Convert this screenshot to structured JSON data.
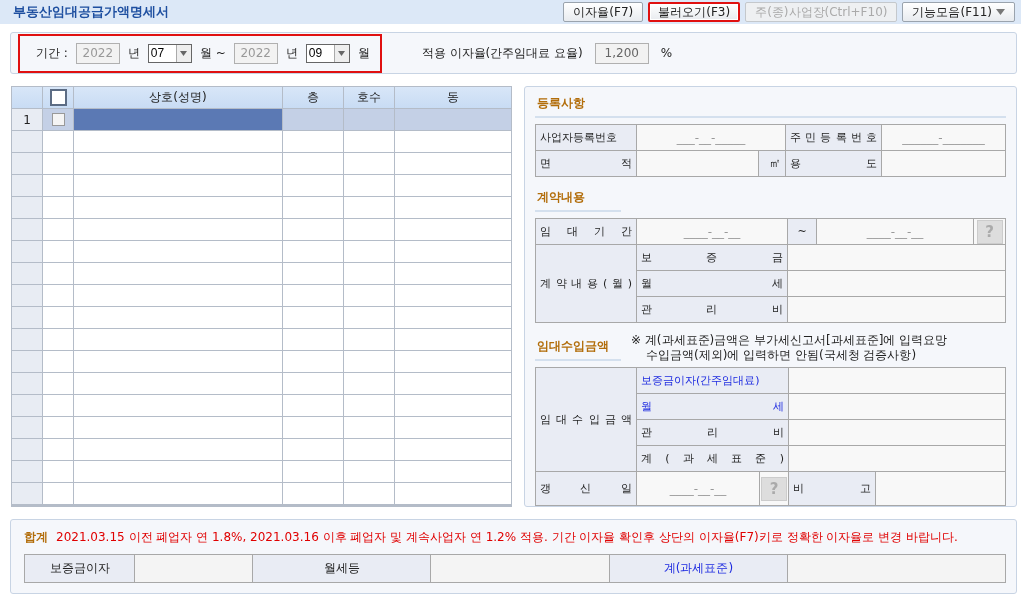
{
  "title": "부동산임대공급가액명세서",
  "toolbar": [
    {
      "kind": "button",
      "label": "이자율(F7)",
      "disabled": false,
      "highlighted": false
    },
    {
      "kind": "button",
      "label": "불러오기(F3)",
      "disabled": false,
      "highlighted": true
    },
    {
      "kind": "button",
      "label": "주(종)사업장(Ctrl+F10)",
      "disabled": true,
      "highlighted": false
    },
    {
      "kind": "menu",
      "label": "기능모음(F11)",
      "disabled": false,
      "highlighted": false
    }
  ],
  "period": {
    "label": "기간 :",
    "highlighted": true,
    "parts": [
      {
        "kind": "year",
        "value": "2022",
        "disabled": true
      },
      {
        "kind": "unit",
        "text": "년"
      },
      {
        "kind": "month",
        "value": "07"
      },
      {
        "kind": "unit",
        "text": "월 ~"
      },
      {
        "kind": "year",
        "value": "2022",
        "disabled": true
      },
      {
        "kind": "unit",
        "text": "년"
      },
      {
        "kind": "month",
        "value": "09"
      },
      {
        "kind": "unit",
        "text": "월"
      }
    ]
  },
  "rate": {
    "label": "적용 이자율(간주임대료 요율)",
    "value": "1,200",
    "unit": "%"
  },
  "grid": {
    "header_checked": false,
    "columns": [
      "상호(성명)",
      "층",
      "호수",
      "동"
    ],
    "rows": [
      {
        "number": "1",
        "checked": false,
        "selected": true
      }
    ]
  },
  "registration": {
    "title": "등록사항",
    "business_no": {
      "label": "사업자등록번호",
      "placeholder": "___-__-_____"
    },
    "resident_no": {
      "label": "주 민 등 록 번 호",
      "placeholder": "______-_______"
    },
    "area": {
      "label": "면 적",
      "unit": "㎡"
    },
    "usage": {
      "label": "용 도"
    }
  },
  "contract": {
    "title": "계약내용",
    "period": {
      "label": "임 대 기 간",
      "from_placeholder": "____-__-__",
      "separator": "~",
      "to_placeholder": "____-__-__",
      "help_button": "?"
    },
    "label": "계 약 내 용 ( 월 )",
    "items": [
      {
        "label": "보 증 금"
      },
      {
        "label": "월 세"
      },
      {
        "label": "관 리 비"
      }
    ]
  },
  "income": {
    "title": "임대수입금액",
    "note": [
      "※ 계(과세표준)금액은 부가세신고서[과세표준]에 입력요망",
      "수입금액(제외)에 입력하면 안됨(국세청 검증사항)"
    ],
    "label": "임 대 수 입 금 액",
    "items": [
      {
        "label": "보증금이자(간주임대료)",
        "emphasized": true
      },
      {
        "label": "월 세",
        "emphasized": true
      },
      {
        "label": "관 리 비",
        "emphasized": false
      },
      {
        "label": "계 ( 과 세 표 준 )",
        "emphasized": false
      }
    ],
    "renewal": {
      "label": "갱 신 일",
      "placeholder": "____-__-__",
      "help_button": "?"
    },
    "remark": {
      "label": "비 고"
    }
  },
  "summary": {
    "title": "합계",
    "notice": "2021.03.15 이전 폐업자 연 1.8%, 2021.03.16 이후 폐업자 및 계속사업자 연 1.2% 적용. 기간 이자율 확인후 상단의 이자율(F7)키로 정확한 이자율로 변경 바랍니다.",
    "cells": [
      {
        "label": "보증금이자",
        "emphasized": false
      },
      {
        "label": "월세등",
        "emphasized": false
      },
      {
        "label": "계(과세표준)",
        "emphasized": true
      }
    ]
  }
}
